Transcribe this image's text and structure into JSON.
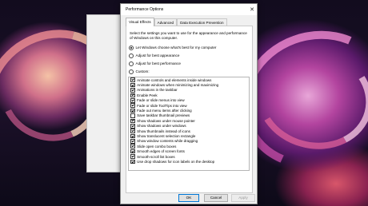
{
  "window": {
    "title": "Performance Options",
    "close_glyph": "✕",
    "tabs": [
      {
        "label": "Visual Effects",
        "active": true
      },
      {
        "label": "Advanced",
        "active": false
      },
      {
        "label": "Data Execution Prevention",
        "active": false
      }
    ],
    "intro": "Select the settings you want to use for the appearance and performance of Windows on this computer.",
    "radios": [
      {
        "label": "Let Windows choose what's best for my computer",
        "selected": true
      },
      {
        "label": "Adjust for best appearance",
        "selected": false
      },
      {
        "label": "Adjust for best performance",
        "selected": false
      },
      {
        "label": "Custom:",
        "selected": false
      }
    ],
    "options": [
      {
        "label": "Animate controls and elements inside windows",
        "checked": true
      },
      {
        "label": "Animate windows when minimizing and maximizing",
        "checked": true
      },
      {
        "label": "Animations in the taskbar",
        "checked": true
      },
      {
        "label": "Enable Peek",
        "checked": true
      },
      {
        "label": "Fade or slide menus into view",
        "checked": true
      },
      {
        "label": "Fade or slide ToolTips into view",
        "checked": true
      },
      {
        "label": "Fade out menu items after clicking",
        "checked": true
      },
      {
        "label": "Save taskbar thumbnail previews",
        "checked": false
      },
      {
        "label": "Show shadows under mouse pointer",
        "checked": true
      },
      {
        "label": "Show shadows under windows",
        "checked": true
      },
      {
        "label": "Show thumbnails instead of icons",
        "checked": true
      },
      {
        "label": "Show translucent selection rectangle",
        "checked": true
      },
      {
        "label": "Show window contents while dragging",
        "checked": true
      },
      {
        "label": "Slide open combo boxes",
        "checked": true
      },
      {
        "label": "Smooth edges of screen fonts",
        "checked": true
      },
      {
        "label": "Smooth-scroll list boxes",
        "checked": true
      },
      {
        "label": "Use drop shadows for icon labels on the desktop",
        "checked": true
      }
    ],
    "buttons": {
      "ok": "OK",
      "cancel": "Cancel",
      "apply": "Apply"
    }
  }
}
